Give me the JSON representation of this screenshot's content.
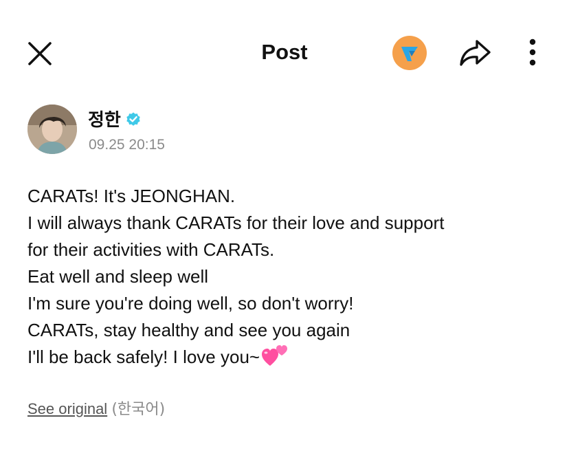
{
  "header": {
    "title": "Post",
    "close_icon": "close-icon",
    "logo_icon": "seventeen-logo-icon",
    "share_icon": "share-arrow-icon",
    "more_icon": "more-vertical-icon",
    "logo_color": "#f5a04b",
    "logo_mark_color": "#2aa6e6"
  },
  "author": {
    "name": "정한",
    "verified_icon": "verified-badge-icon",
    "verified_color": "#3fc9e8",
    "timestamp": "09.25 20:15"
  },
  "post": {
    "lines": [
      "CARATs! It's JEONGHAN.",
      "I will always thank CARATs for their love and support",
      "for their activities with CARATs.",
      "Eat well and sleep well",
      "I'm sure you're doing well, so don't worry!",
      "CARATs, stay healthy and see you again",
      "I'll be back safely! I love you~"
    ],
    "emoji_icon": "two-hearts-icon",
    "emoji_color": "#ff4fa0"
  },
  "footer": {
    "see_original": "See original",
    "language": "(한국어)"
  }
}
